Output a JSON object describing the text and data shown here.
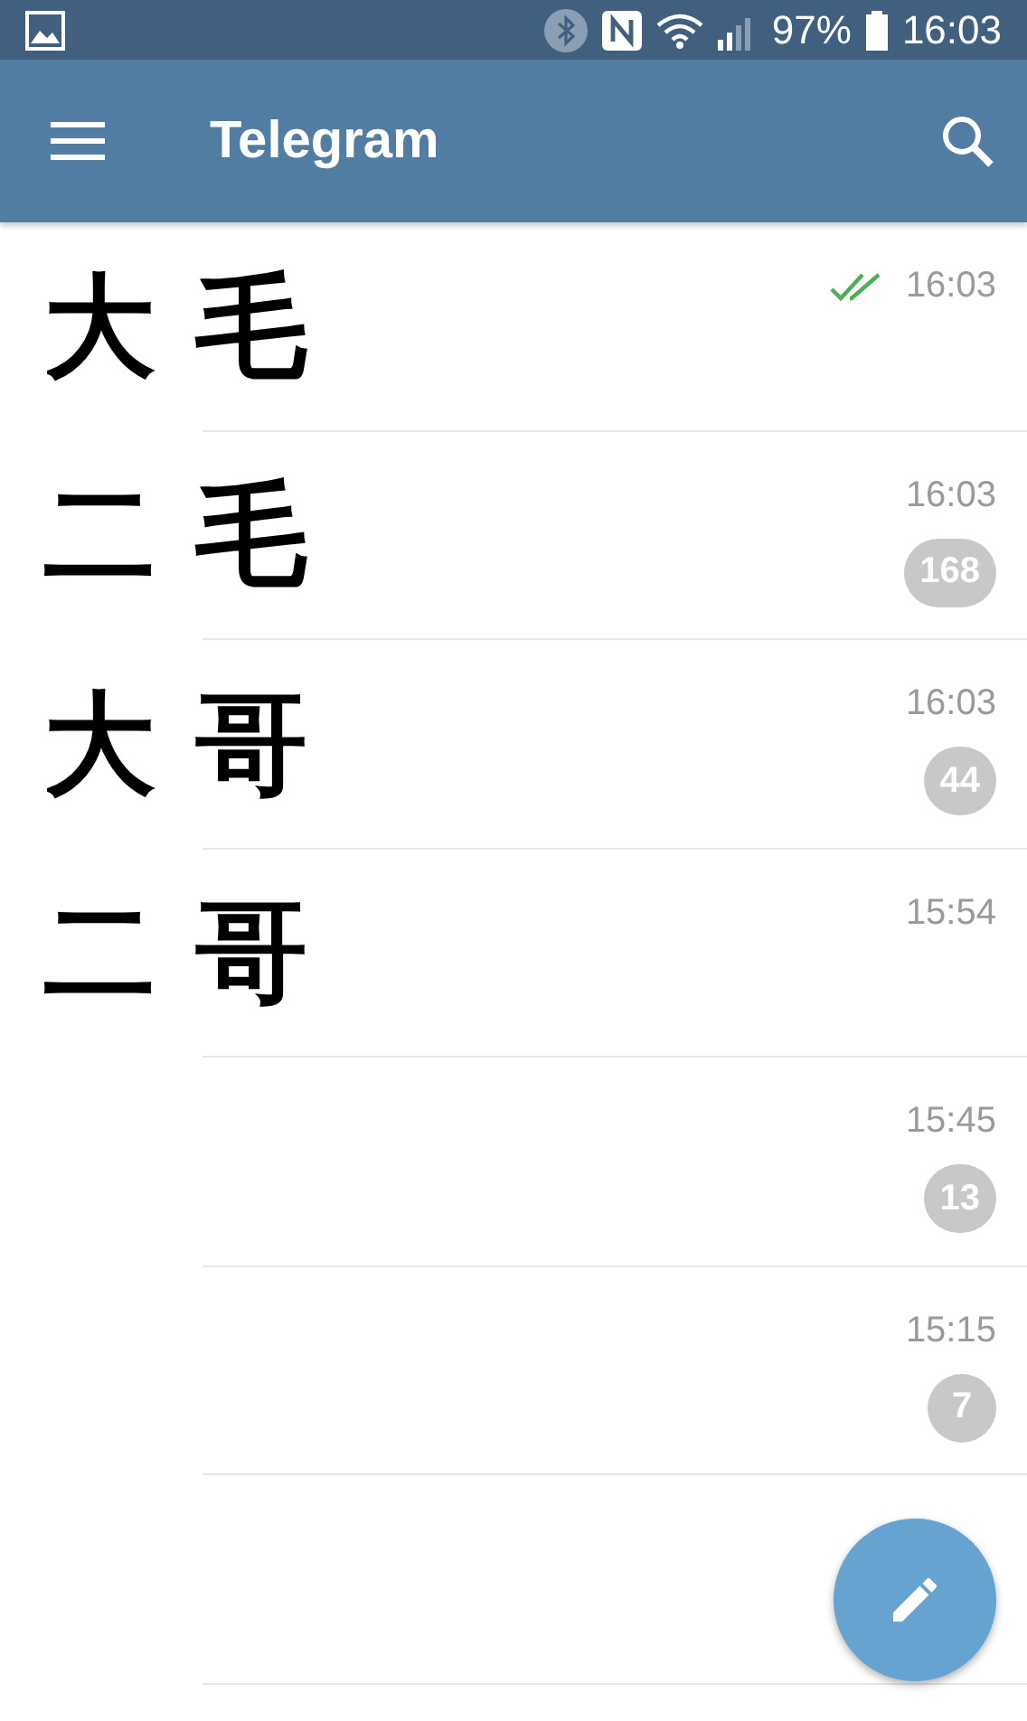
{
  "status_bar": {
    "battery": "97%",
    "time": "16:03"
  },
  "app_bar": {
    "title": "Telegram"
  },
  "chats": [
    {
      "name": "大毛",
      "time": "16:03",
      "read": true
    },
    {
      "name": "二毛",
      "time": "16:03",
      "unread": "168",
      "read": false
    },
    {
      "name": "大哥",
      "time": "16:03",
      "unread": "44",
      "read": false
    },
    {
      "name": "二哥",
      "time": "15:54",
      "read": false
    },
    {
      "time": "15:45",
      "unread": "13",
      "read": false
    },
    {
      "time": "15:15",
      "unread": "7",
      "read": false
    },
    {
      "read": false
    }
  ]
}
